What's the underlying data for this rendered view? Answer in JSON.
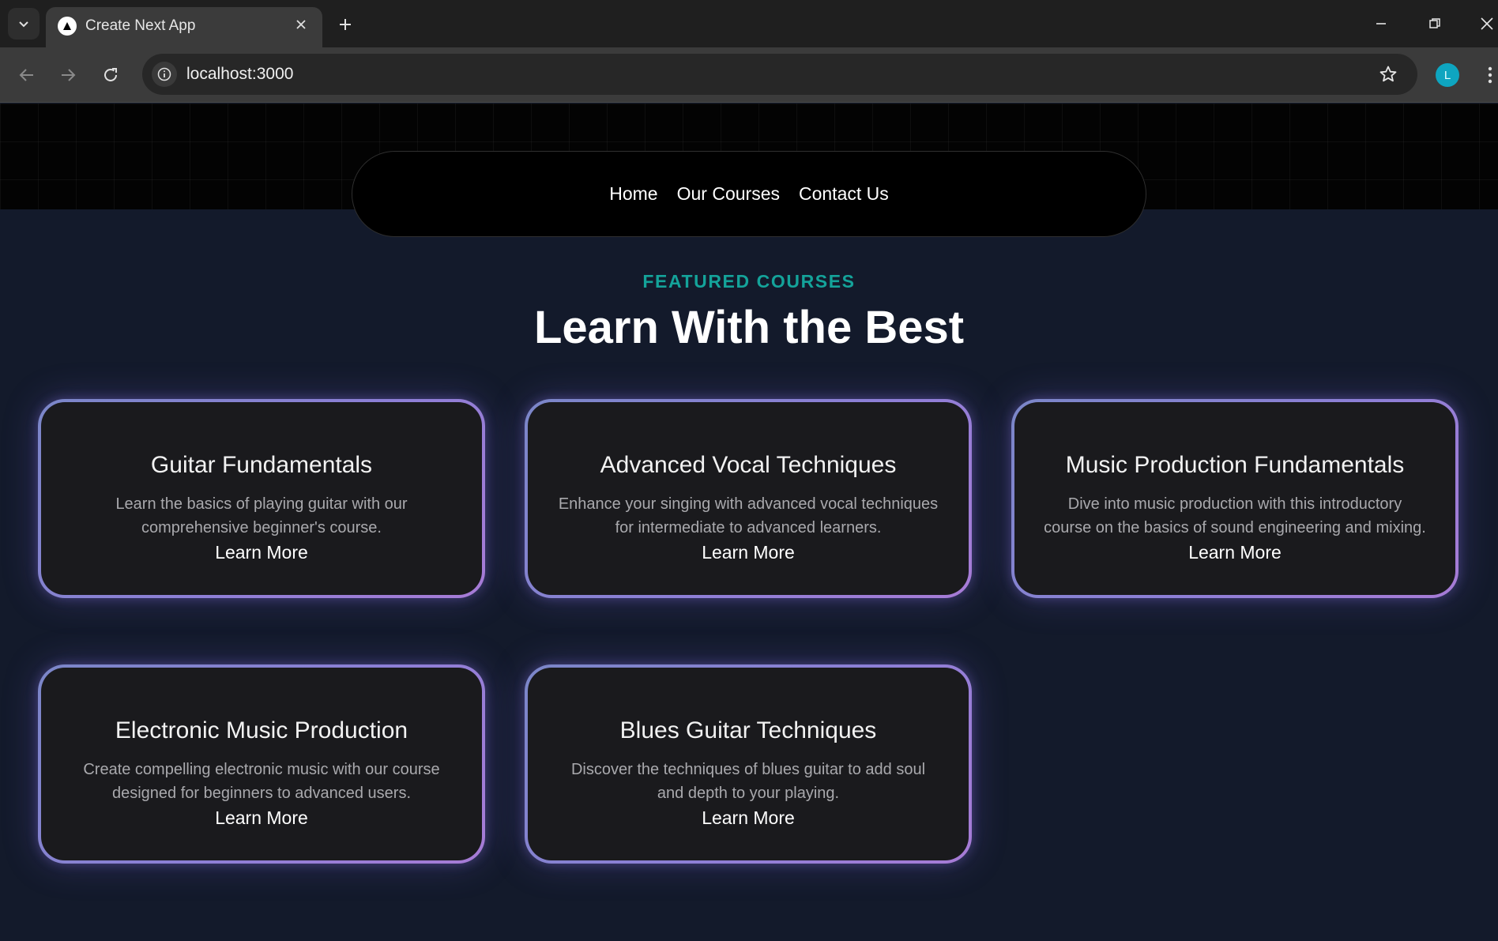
{
  "browser": {
    "tab_title": "Create Next App",
    "url": "localhost:3000",
    "profile_initial": "L"
  },
  "nav": {
    "links": [
      "Home",
      "Our Courses",
      "Contact Us"
    ]
  },
  "section": {
    "eyebrow": "FEATURED COURSES",
    "title": "Learn With the Best"
  },
  "courses": [
    {
      "title": "Guitar Fundamentals",
      "description": "Learn the basics of playing guitar with our comprehensive beginner's course.",
      "cta": "Learn More"
    },
    {
      "title": "Advanced Vocal Techniques",
      "description": "Enhance your singing with advanced vocal techniques for intermediate to advanced learners.",
      "cta": "Learn More"
    },
    {
      "title": "Music Production Fundamentals",
      "description": "Dive into music production with this introductory course on the basics of sound engineering and mixing.",
      "cta": "Learn More"
    },
    {
      "title": "Electronic Music Production",
      "description": "Create compelling electronic music with our course designed for beginners to advanced users.",
      "cta": "Learn More"
    },
    {
      "title": "Blues Guitar Techniques",
      "description": "Discover the techniques of blues guitar to add soul and depth to your playing.",
      "cta": "Learn More"
    }
  ],
  "colors": {
    "accent_teal": "#14a39a",
    "card_border_start": "#7b86c8",
    "card_border_end": "#a77bd6",
    "page_bg": "#131a2b"
  }
}
